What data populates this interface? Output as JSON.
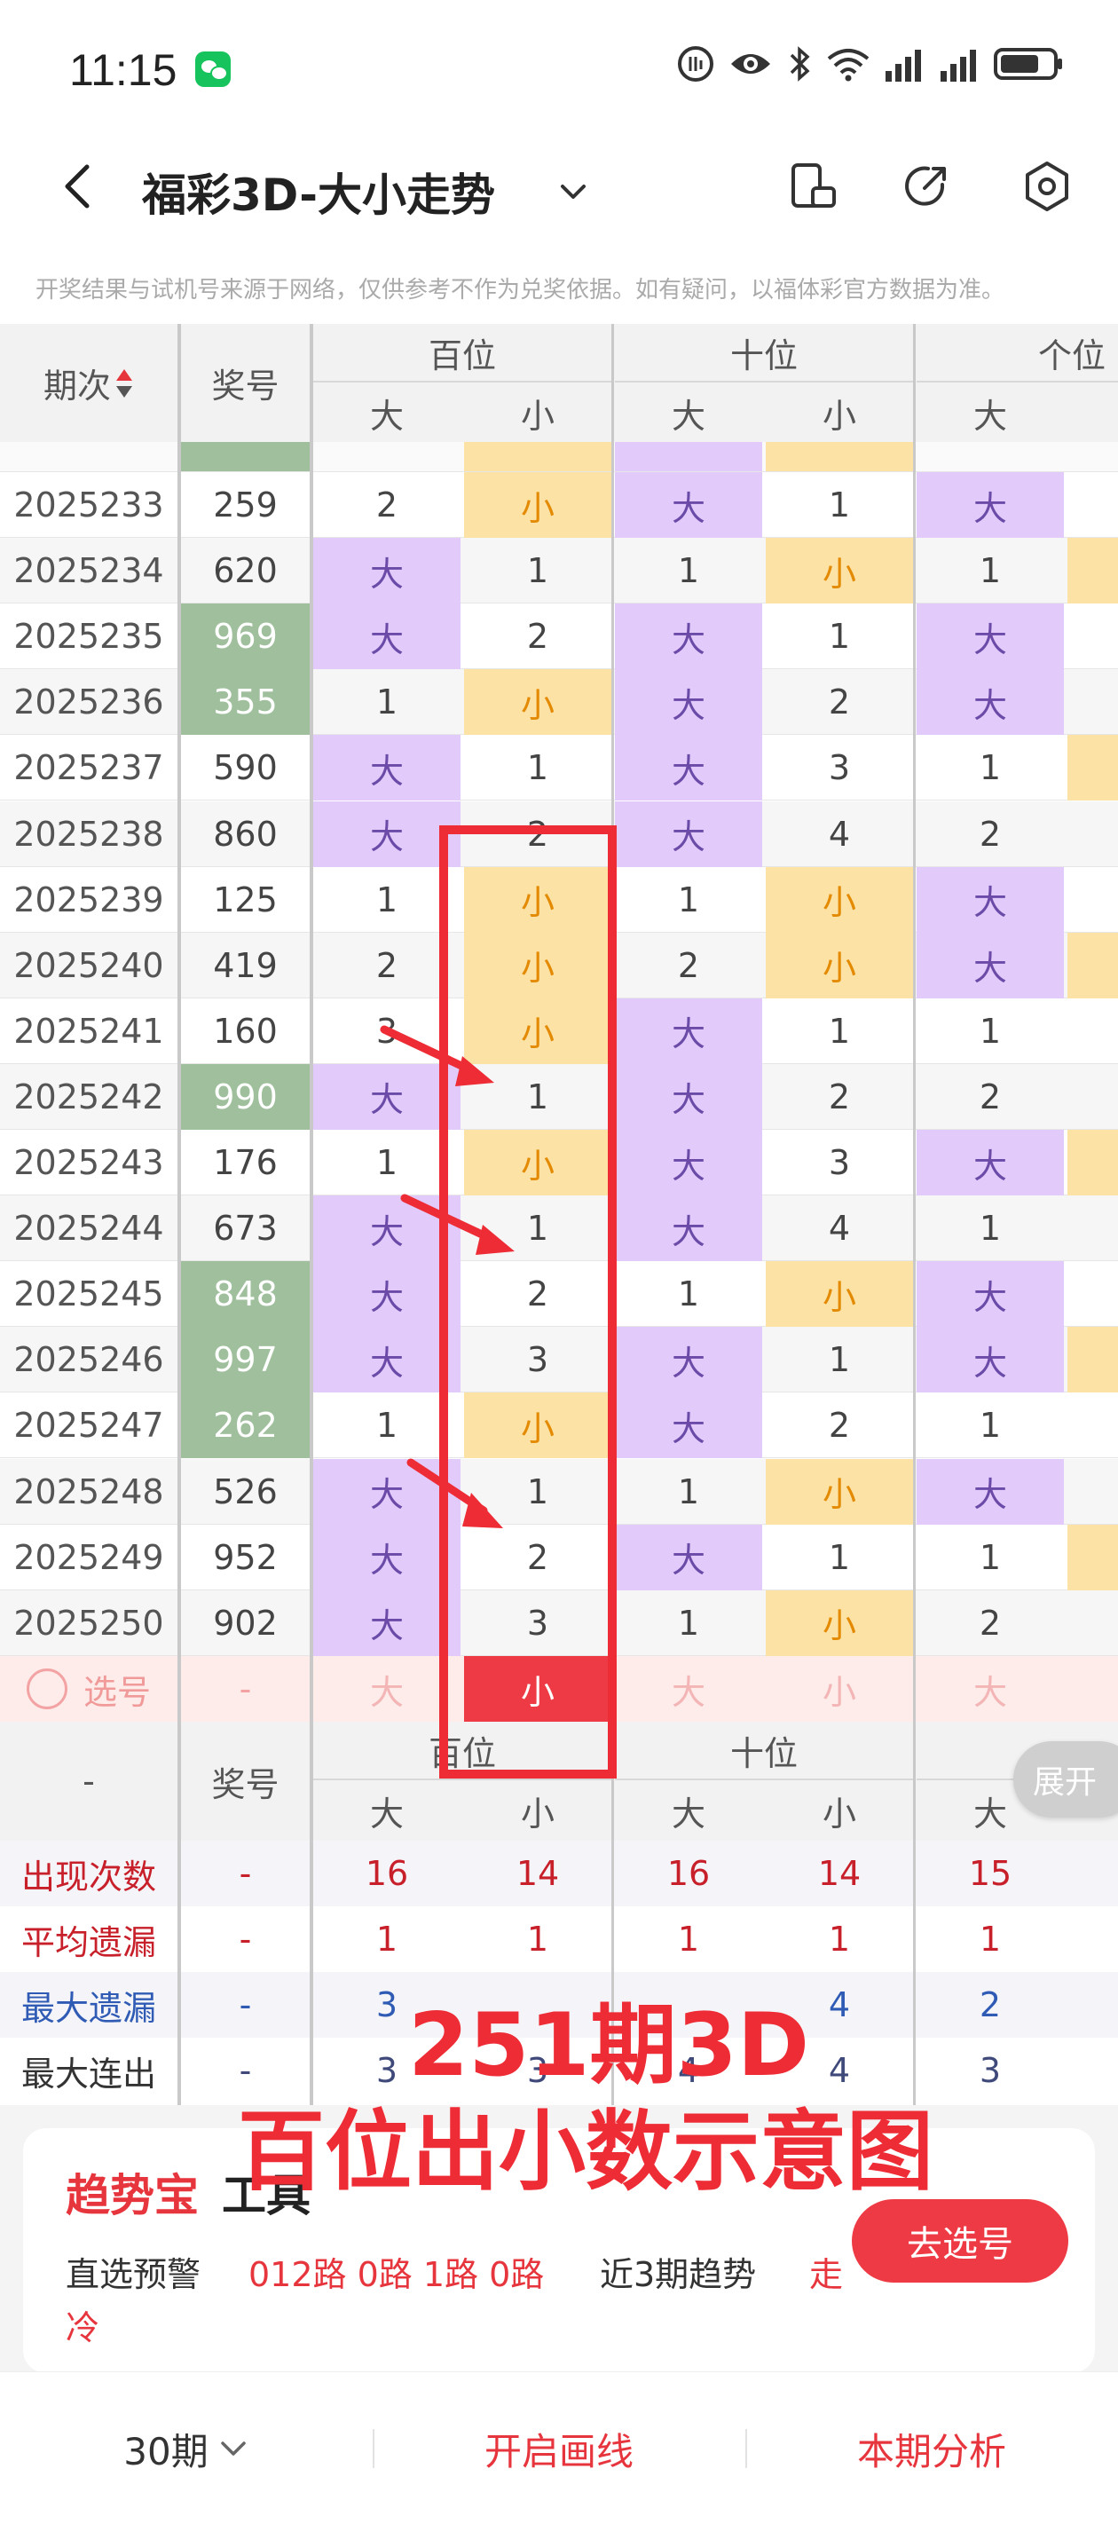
{
  "status_bar": {
    "time": "11:15"
  },
  "nav": {
    "title": "福彩3D-大小走势"
  },
  "disclaimer": "开奖结果与试机号来源于网络，仅供参考不作为兑奖依据。如有疑问，以福体彩官方数据为准。",
  "table": {
    "header": {
      "issue": "期次",
      "number": "奖号",
      "groups": [
        "百位",
        "十位",
        "个位"
      ],
      "subcols": [
        "大",
        "小",
        "大",
        "小",
        "大"
      ]
    },
    "rows": [
      {
        "issue": "2025233",
        "num": "259",
        "hot": false,
        "cells": [
          "2",
          "小",
          "大",
          "1",
          "大"
        ]
      },
      {
        "issue": "2025234",
        "num": "620",
        "hot": false,
        "cells": [
          "大",
          "1",
          "1",
          "小",
          "1"
        ]
      },
      {
        "issue": "2025235",
        "num": "969",
        "hot": true,
        "cells": [
          "大",
          "2",
          "大",
          "1",
          "大"
        ]
      },
      {
        "issue": "2025236",
        "num": "355",
        "hot": true,
        "cells": [
          "1",
          "小",
          "大",
          "2",
          "大"
        ]
      },
      {
        "issue": "2025237",
        "num": "590",
        "hot": false,
        "cells": [
          "大",
          "1",
          "大",
          "3",
          "1"
        ]
      },
      {
        "issue": "2025238",
        "num": "860",
        "hot": false,
        "cells": [
          "大",
          "2",
          "大",
          "4",
          "2"
        ]
      },
      {
        "issue": "2025239",
        "num": "125",
        "hot": false,
        "cells": [
          "1",
          "小",
          "1",
          "小",
          "大"
        ]
      },
      {
        "issue": "2025240",
        "num": "419",
        "hot": false,
        "cells": [
          "2",
          "小",
          "2",
          "小",
          "大"
        ]
      },
      {
        "issue": "2025241",
        "num": "160",
        "hot": false,
        "cells": [
          "3",
          "小",
          "大",
          "1",
          "1"
        ]
      },
      {
        "issue": "2025242",
        "num": "990",
        "hot": true,
        "cells": [
          "大",
          "1",
          "大",
          "2",
          "2"
        ]
      },
      {
        "issue": "2025243",
        "num": "176",
        "hot": false,
        "cells": [
          "1",
          "小",
          "大",
          "3",
          "大"
        ]
      },
      {
        "issue": "2025244",
        "num": "673",
        "hot": false,
        "cells": [
          "大",
          "1",
          "大",
          "4",
          "1"
        ]
      },
      {
        "issue": "2025245",
        "num": "848",
        "hot": true,
        "cells": [
          "大",
          "2",
          "1",
          "小",
          "大"
        ]
      },
      {
        "issue": "2025246",
        "num": "997",
        "hot": true,
        "cells": [
          "大",
          "3",
          "大",
          "1",
          "大"
        ]
      },
      {
        "issue": "2025247",
        "num": "262",
        "hot": true,
        "cells": [
          "1",
          "小",
          "大",
          "2",
          "1"
        ]
      },
      {
        "issue": "2025248",
        "num": "526",
        "hot": false,
        "cells": [
          "大",
          "1",
          "1",
          "小",
          "大"
        ]
      },
      {
        "issue": "2025249",
        "num": "952",
        "hot": false,
        "cells": [
          "大",
          "2",
          "大",
          "1",
          "1"
        ]
      },
      {
        "issue": "2025250",
        "num": "902",
        "hot": false,
        "cells": [
          "大",
          "3",
          "1",
          "小",
          "2"
        ]
      }
    ],
    "select_row": {
      "label": "选号",
      "num": "-",
      "cells": [
        "大",
        "小",
        "大",
        "小",
        "大"
      ]
    }
  },
  "stats": {
    "header": {
      "issue": "-",
      "number": "奖号",
      "groups": [
        "百位",
        "十位"
      ],
      "subcols": [
        "大",
        "小",
        "大",
        "小",
        "大"
      ]
    },
    "rows": [
      {
        "label": "出现次数",
        "num": "-",
        "values": [
          "16",
          "14",
          "16",
          "14",
          "15"
        ]
      },
      {
        "label": "平均遗漏",
        "num": "-",
        "values": [
          "1",
          "1",
          "1",
          "1",
          "1"
        ]
      },
      {
        "label": "最大遗漏",
        "num": "-",
        "values": [
          "3",
          "",
          "",
          "4",
          "2"
        ]
      },
      {
        "label": "最大连出",
        "num": "-",
        "values": [
          "3",
          "3",
          "4",
          "4",
          "3"
        ]
      }
    ],
    "expand_label": "展开"
  },
  "overlay": {
    "line1": "251期3D",
    "line2": "百位出小数示意图"
  },
  "trend_card": {
    "title_red": "趋势宝",
    "title_black": "工具",
    "label_direct": "直选预警",
    "routes": "012路 0路 1路 0路",
    "label_recent": "近3期趋势",
    "trend_part1": "走",
    "trend_part2": "冷",
    "go_button": "去选号"
  },
  "bottom_bar": {
    "periods": "30期",
    "draw_line": "开启画线",
    "analysis": "本期分析"
  },
  "colors": {
    "accent": "#ee3a44",
    "big_bg": "#e2cbfb",
    "small_bg": "#fde2a6",
    "hot_num_bg": "#9fbf9d"
  }
}
